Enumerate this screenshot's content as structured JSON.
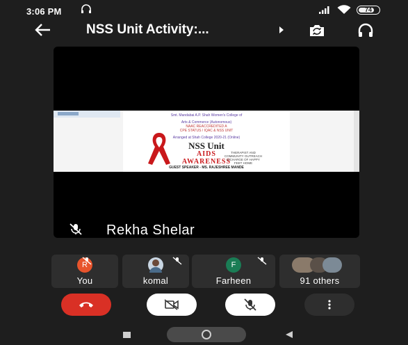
{
  "status_bar": {
    "time": "3:06 PM",
    "battery": "74",
    "icons": [
      "headset-icon",
      "signal-icon",
      "wifi-icon",
      "battery-icon"
    ]
  },
  "header": {
    "title": "NSS Unit Activity:...",
    "icons": [
      "back-arrow-icon",
      "caret-right-icon",
      "switch-camera-icon",
      "headphones-icon"
    ]
  },
  "main_video": {
    "presenter_name": "Rekha Shelar",
    "shared_screen": {
      "poster_header_line1": "Smt. Mandabai A.P. Shah Women's College of",
      "poster_header_line2": "Arts & Commerce (Autonomous)",
      "poster_header_line3": "NAAC REACCREDITED A",
      "poster_header_line4": "CPE STATUS / IQAC & NSS UNIT",
      "poster_header_line5": "Arranged at Shah College 2020-21 (Online)",
      "poster_title": "NSS Unit",
      "poster_subtitle_1": "AIDS",
      "poster_subtitle_2": "AWARENESS",
      "poster_guest": "GUEST SPEAKER - MS. RAJESHREE MANDE",
      "poster_roles": [
        "THERAPIST AND",
        "COMMUNITY OUTREACH",
        "INCHARGE OF HAPPY",
        "FEET HOME"
      ]
    }
  },
  "participants": [
    {
      "name": "You",
      "avatar": "R",
      "avatar_color": "#e8542c",
      "muted": true
    },
    {
      "name": "komal",
      "avatar": "",
      "avatar_color": "#c9d6e3",
      "muted": true
    },
    {
      "name": "Farheen",
      "avatar": "F",
      "avatar_color": "#1a7d55",
      "muted": true
    },
    {
      "name": "91 others",
      "avatar": "",
      "avatar_color": "#8a7a6a",
      "muted": false
    }
  ],
  "controls": {
    "end_call": "end-call-icon",
    "camera": "camera-off-icon",
    "mic": "mic-off-icon",
    "more": "more-vert-icon"
  },
  "colors": {
    "background": "#1e1e1e",
    "end_call": "#d93025",
    "tile": "#2e2e2e",
    "ribbon_red": "#c9181b"
  }
}
